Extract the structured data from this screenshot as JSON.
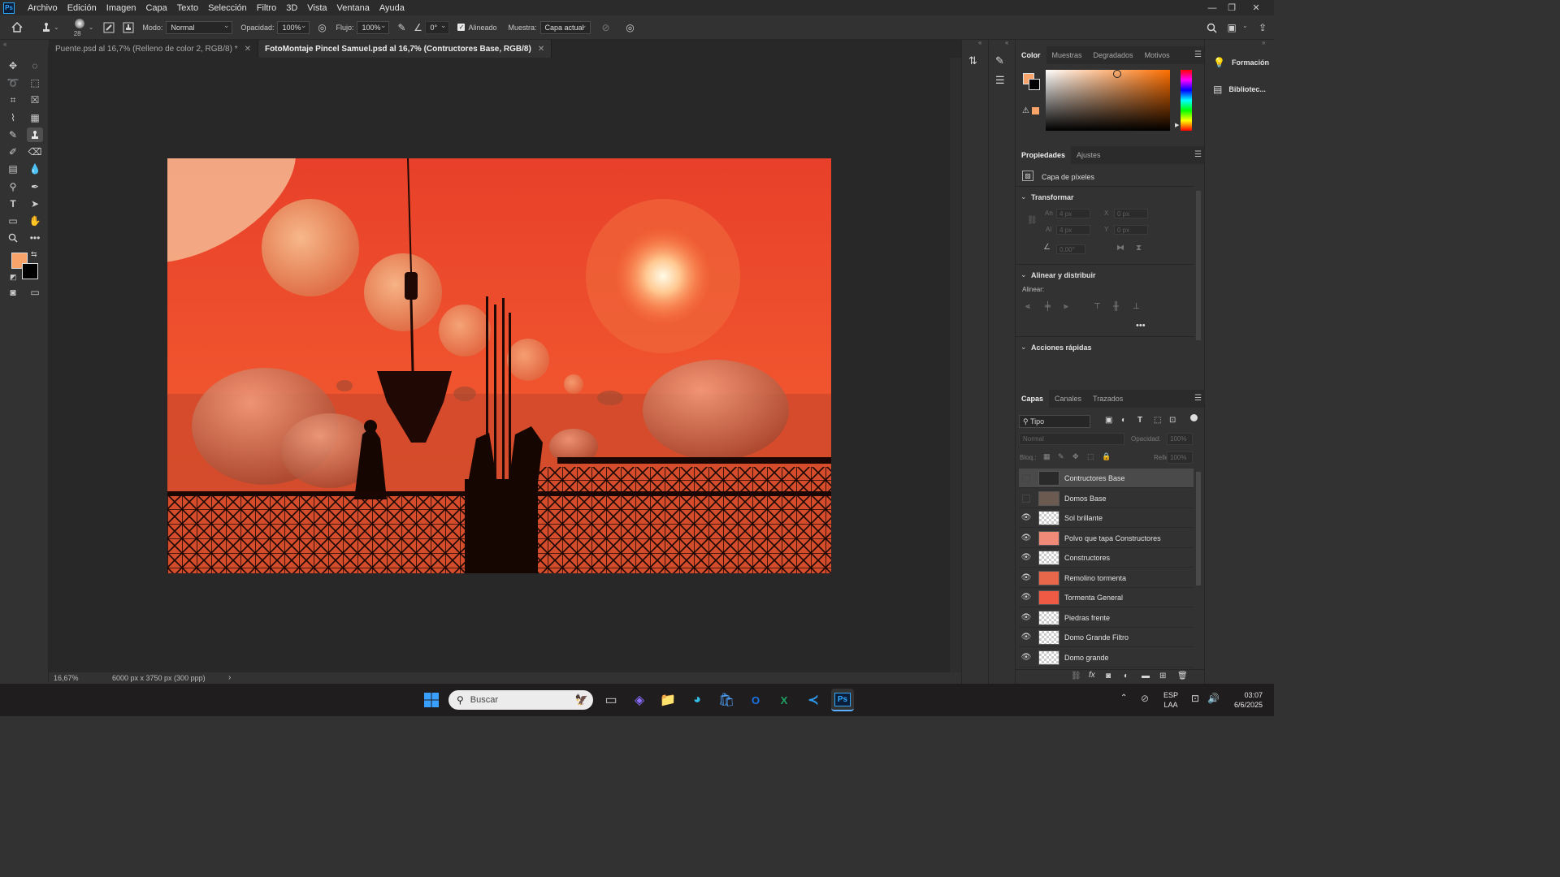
{
  "menubar": {
    "app_icon": "Ps",
    "items": [
      "Archivo",
      "Edición",
      "Imagen",
      "Capa",
      "Texto",
      "Selección",
      "Filtro",
      "3D",
      "Vista",
      "Ventana",
      "Ayuda"
    ]
  },
  "options_bar": {
    "brush_size": "28",
    "mode_label": "Modo:",
    "mode_value": "Normal",
    "opacity_label": "Opacidad:",
    "opacity_value": "100%",
    "flow_label": "Flujo:",
    "flow_value": "100%",
    "angle_value": "0°",
    "aligned_label": "Alineado",
    "aligned_checked": true,
    "sample_label": "Muestra:",
    "sample_value": "Capa actual"
  },
  "documents": {
    "tabs": [
      {
        "label": "Puente.psd al 16,7% (Relleno de color 2, RGB/8) *",
        "active": false
      },
      {
        "label": "FotoMontaje Pincel Samuel.psd al 16,7% (Contructores Base, RGB/8)",
        "active": true
      }
    ]
  },
  "status_bar": {
    "zoom": "16,67%",
    "doc_size": "6000 px x 3750 px (300 ppp)"
  },
  "colors": {
    "foreground": "#f7a36a",
    "background": "#000000",
    "accent": "#31a8ff"
  },
  "color_panel": {
    "tabs": [
      "Color",
      "Muestras",
      "Degradados",
      "Motivos"
    ],
    "active_tab": "Color"
  },
  "properties_panel": {
    "tabs": [
      "Propiedades",
      "Ajustes"
    ],
    "active_tab": "Propiedades",
    "layer_type": "Capa de píxeles",
    "transform_title": "Transformar",
    "width_label": "An",
    "width_value": "4 px",
    "x_label": "X",
    "x_value": "0 px",
    "height_label": "Al",
    "height_value": "4 px",
    "y_label": "Y",
    "y_value": "0 px",
    "angle_value": "0,00°",
    "align_title": "Alinear y distribuir",
    "align_label": "Alinear:",
    "quick_actions_title": "Acciones rápidas"
  },
  "layers_panel": {
    "tabs": [
      "Capas",
      "Canales",
      "Trazados"
    ],
    "active_tab": "Capas",
    "filter_kind": "Tipo",
    "blend_mode": "Normal",
    "opacity_label": "Opacidad:",
    "opacity_value": "100%",
    "lock_label": "Bloq.:",
    "fill_label": "Relleno:",
    "fill_value": "100%",
    "layers": [
      {
        "name": "Contructores Base",
        "visible": false,
        "selected": true
      },
      {
        "name": "Domos Base",
        "visible": false,
        "selected": false
      },
      {
        "name": "Sol brillante",
        "visible": true,
        "selected": false
      },
      {
        "name": "Polvo que tapa Constructores",
        "visible": true,
        "selected": false
      },
      {
        "name": "Constructores",
        "visible": true,
        "selected": false
      },
      {
        "name": "Remolino tormenta",
        "visible": true,
        "selected": false
      },
      {
        "name": "Tormenta General",
        "visible": true,
        "selected": false
      },
      {
        "name": "Piedras frente",
        "visible": true,
        "selected": false
      },
      {
        "name": "Domo Grande Filtro",
        "visible": true,
        "selected": false
      },
      {
        "name": "Domo grande",
        "visible": true,
        "selected": false
      }
    ]
  },
  "far_right_panel": {
    "items": [
      "Formación",
      "Bibliotec..."
    ]
  },
  "taskbar": {
    "search_placeholder": "Buscar",
    "lang_line1": "ESP",
    "lang_line2": "LAA",
    "time": "03:07",
    "date": "6/6/2025"
  }
}
